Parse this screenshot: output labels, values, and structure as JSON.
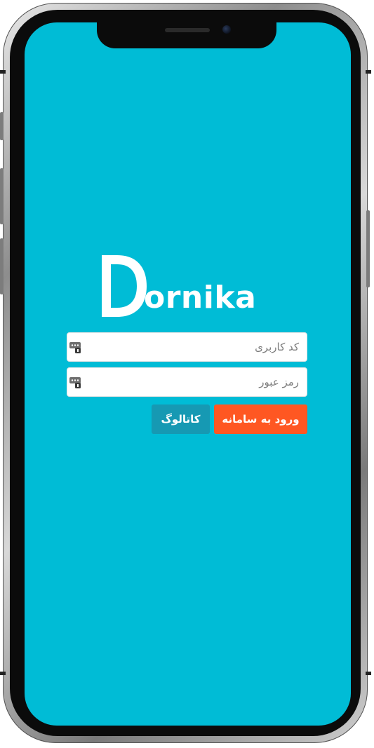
{
  "logo": {
    "text": "ornika"
  },
  "login": {
    "username_placeholder": "کد کاربری",
    "password_placeholder": "رمز عبور",
    "login_button": "ورود به سامانه",
    "catalog_button": "کاتالوگ"
  },
  "colors": {
    "screen_background": "#00bcd6",
    "login_button": "#ff5722",
    "catalog_button": "#1699b3"
  },
  "icons": {
    "field_icon": "password-manager-key-icon"
  }
}
